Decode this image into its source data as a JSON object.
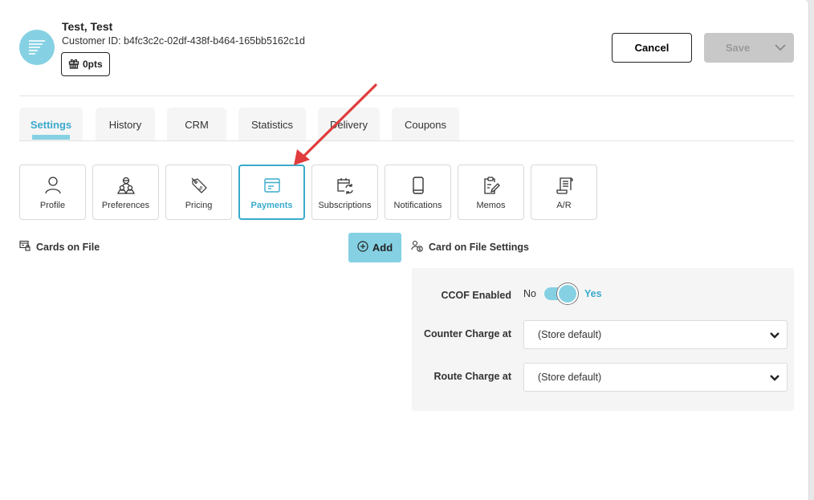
{
  "customer": {
    "name": "Test, Test",
    "id_label": "Customer ID: b4fc3c2c-02df-438f-b464-165bb5162c1d",
    "points": "0pts"
  },
  "header_actions": {
    "cancel_label": "Cancel",
    "save_label": "Save"
  },
  "tabs": [
    {
      "label": "Settings",
      "active": true
    },
    {
      "label": "History",
      "active": false
    },
    {
      "label": "CRM",
      "active": false
    },
    {
      "label": "Statistics",
      "active": false
    },
    {
      "label": "Delivery",
      "active": false
    },
    {
      "label": "Coupons",
      "active": false
    }
  ],
  "subtabs": [
    {
      "label": "Profile",
      "icon": "person-icon",
      "active": false
    },
    {
      "label": "Preferences",
      "icon": "group-icon",
      "active": false
    },
    {
      "label": "Pricing",
      "icon": "price-tag-icon",
      "active": false
    },
    {
      "label": "Payments",
      "icon": "payment-card-icon",
      "active": true
    },
    {
      "label": "Subscriptions",
      "icon": "calendar-refresh-icon",
      "active": false
    },
    {
      "label": "Notifications",
      "icon": "phone-icon",
      "active": false
    },
    {
      "label": "Memos",
      "icon": "clipboard-edit-icon",
      "active": false
    },
    {
      "label": "A/R",
      "icon": "receipt-scroll-icon",
      "active": false
    }
  ],
  "cards_on_file": {
    "title": "Cards on File",
    "add_label": "Add"
  },
  "cof_settings": {
    "title": "Card on File Settings",
    "ccof_label": "CCOF Enabled",
    "toggle_off_label": "No",
    "toggle_on_label": "Yes",
    "ccof_enabled": true,
    "counter_charge_label": "Counter Charge at",
    "counter_charge_value": "(Store default)",
    "route_charge_label": "Route Charge at",
    "route_charge_value": "(Store default)"
  },
  "colors": {
    "accent": "#3aaacb",
    "accent_light": "#85d1e3",
    "annotation_arrow": "#e03c3c"
  }
}
